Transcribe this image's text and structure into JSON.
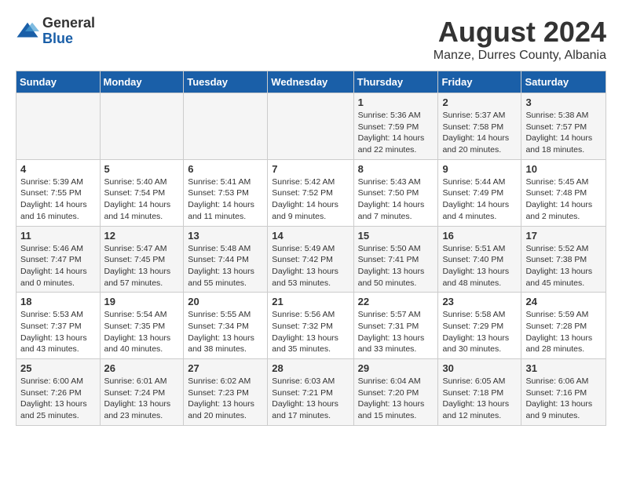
{
  "logo": {
    "general": "General",
    "blue": "Blue"
  },
  "title": "August 2024",
  "subtitle": "Manze, Durres County, Albania",
  "headers": [
    "Sunday",
    "Monday",
    "Tuesday",
    "Wednesday",
    "Thursday",
    "Friday",
    "Saturday"
  ],
  "weeks": [
    [
      {
        "day": "",
        "info": ""
      },
      {
        "day": "",
        "info": ""
      },
      {
        "day": "",
        "info": ""
      },
      {
        "day": "",
        "info": ""
      },
      {
        "day": "1",
        "info": "Sunrise: 5:36 AM\nSunset: 7:59 PM\nDaylight: 14 hours\nand 22 minutes."
      },
      {
        "day": "2",
        "info": "Sunrise: 5:37 AM\nSunset: 7:58 PM\nDaylight: 14 hours\nand 20 minutes."
      },
      {
        "day": "3",
        "info": "Sunrise: 5:38 AM\nSunset: 7:57 PM\nDaylight: 14 hours\nand 18 minutes."
      }
    ],
    [
      {
        "day": "4",
        "info": "Sunrise: 5:39 AM\nSunset: 7:55 PM\nDaylight: 14 hours\nand 16 minutes."
      },
      {
        "day": "5",
        "info": "Sunrise: 5:40 AM\nSunset: 7:54 PM\nDaylight: 14 hours\nand 14 minutes."
      },
      {
        "day": "6",
        "info": "Sunrise: 5:41 AM\nSunset: 7:53 PM\nDaylight: 14 hours\nand 11 minutes."
      },
      {
        "day": "7",
        "info": "Sunrise: 5:42 AM\nSunset: 7:52 PM\nDaylight: 14 hours\nand 9 minutes."
      },
      {
        "day": "8",
        "info": "Sunrise: 5:43 AM\nSunset: 7:50 PM\nDaylight: 14 hours\nand 7 minutes."
      },
      {
        "day": "9",
        "info": "Sunrise: 5:44 AM\nSunset: 7:49 PM\nDaylight: 14 hours\nand 4 minutes."
      },
      {
        "day": "10",
        "info": "Sunrise: 5:45 AM\nSunset: 7:48 PM\nDaylight: 14 hours\nand 2 minutes."
      }
    ],
    [
      {
        "day": "11",
        "info": "Sunrise: 5:46 AM\nSunset: 7:47 PM\nDaylight: 14 hours\nand 0 minutes."
      },
      {
        "day": "12",
        "info": "Sunrise: 5:47 AM\nSunset: 7:45 PM\nDaylight: 13 hours\nand 57 minutes."
      },
      {
        "day": "13",
        "info": "Sunrise: 5:48 AM\nSunset: 7:44 PM\nDaylight: 13 hours\nand 55 minutes."
      },
      {
        "day": "14",
        "info": "Sunrise: 5:49 AM\nSunset: 7:42 PM\nDaylight: 13 hours\nand 53 minutes."
      },
      {
        "day": "15",
        "info": "Sunrise: 5:50 AM\nSunset: 7:41 PM\nDaylight: 13 hours\nand 50 minutes."
      },
      {
        "day": "16",
        "info": "Sunrise: 5:51 AM\nSunset: 7:40 PM\nDaylight: 13 hours\nand 48 minutes."
      },
      {
        "day": "17",
        "info": "Sunrise: 5:52 AM\nSunset: 7:38 PM\nDaylight: 13 hours\nand 45 minutes."
      }
    ],
    [
      {
        "day": "18",
        "info": "Sunrise: 5:53 AM\nSunset: 7:37 PM\nDaylight: 13 hours\nand 43 minutes."
      },
      {
        "day": "19",
        "info": "Sunrise: 5:54 AM\nSunset: 7:35 PM\nDaylight: 13 hours\nand 40 minutes."
      },
      {
        "day": "20",
        "info": "Sunrise: 5:55 AM\nSunset: 7:34 PM\nDaylight: 13 hours\nand 38 minutes."
      },
      {
        "day": "21",
        "info": "Sunrise: 5:56 AM\nSunset: 7:32 PM\nDaylight: 13 hours\nand 35 minutes."
      },
      {
        "day": "22",
        "info": "Sunrise: 5:57 AM\nSunset: 7:31 PM\nDaylight: 13 hours\nand 33 minutes."
      },
      {
        "day": "23",
        "info": "Sunrise: 5:58 AM\nSunset: 7:29 PM\nDaylight: 13 hours\nand 30 minutes."
      },
      {
        "day": "24",
        "info": "Sunrise: 5:59 AM\nSunset: 7:28 PM\nDaylight: 13 hours\nand 28 minutes."
      }
    ],
    [
      {
        "day": "25",
        "info": "Sunrise: 6:00 AM\nSunset: 7:26 PM\nDaylight: 13 hours\nand 25 minutes."
      },
      {
        "day": "26",
        "info": "Sunrise: 6:01 AM\nSunset: 7:24 PM\nDaylight: 13 hours\nand 23 minutes."
      },
      {
        "day": "27",
        "info": "Sunrise: 6:02 AM\nSunset: 7:23 PM\nDaylight: 13 hours\nand 20 minutes."
      },
      {
        "day": "28",
        "info": "Sunrise: 6:03 AM\nSunset: 7:21 PM\nDaylight: 13 hours\nand 17 minutes."
      },
      {
        "day": "29",
        "info": "Sunrise: 6:04 AM\nSunset: 7:20 PM\nDaylight: 13 hours\nand 15 minutes."
      },
      {
        "day": "30",
        "info": "Sunrise: 6:05 AM\nSunset: 7:18 PM\nDaylight: 13 hours\nand 12 minutes."
      },
      {
        "day": "31",
        "info": "Sunrise: 6:06 AM\nSunset: 7:16 PM\nDaylight: 13 hours\nand 9 minutes."
      }
    ]
  ]
}
